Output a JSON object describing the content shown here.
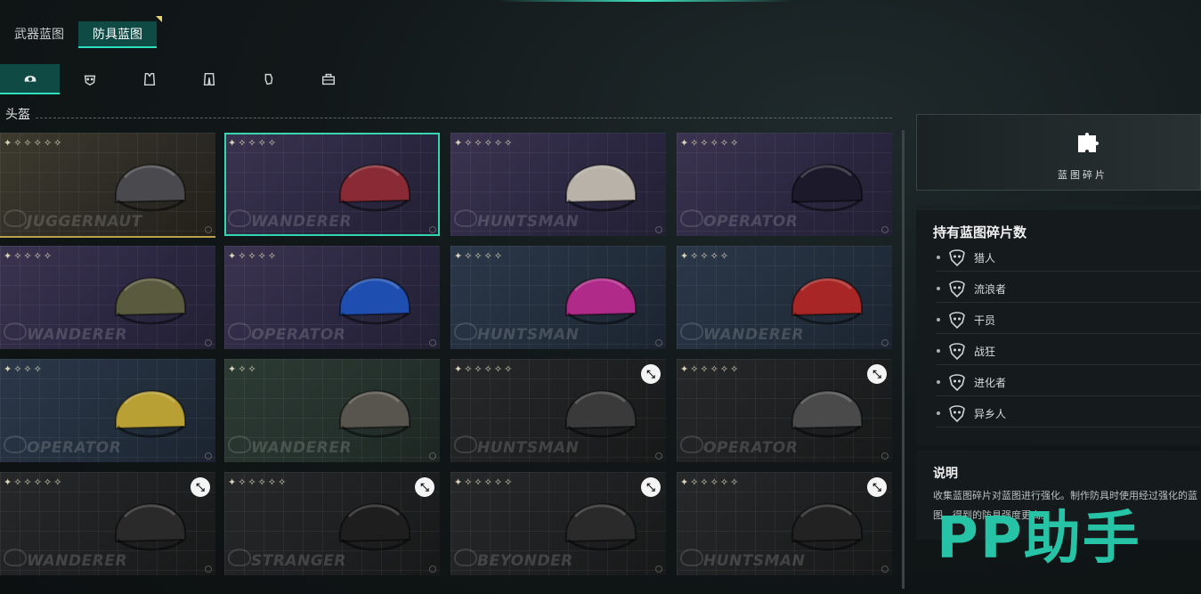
{
  "tabs": [
    {
      "label": "武器蓝图",
      "active": false
    },
    {
      "label": "防具蓝图",
      "active": true
    }
  ],
  "categories": [
    {
      "icon": "helmet-icon",
      "active": true
    },
    {
      "icon": "mask-icon",
      "active": false
    },
    {
      "icon": "armor-vest-icon",
      "active": false
    },
    {
      "icon": "pants-icon",
      "active": false
    },
    {
      "icon": "gloves-icon",
      "active": false
    },
    {
      "icon": "backpack-icon",
      "active": false
    }
  ],
  "section": {
    "title": "头盔"
  },
  "cards": [
    {
      "name": "JUGGERNAUT",
      "stars": "✦✧✧✧✧✧",
      "theme": "gold",
      "locked": false,
      "selected": false,
      "item_color": "#4a4a4e"
    },
    {
      "name": "WANDERER",
      "stars": "✦✧✧✧✧",
      "theme": "purple",
      "locked": false,
      "selected": true,
      "item_color": "#8a2a34"
    },
    {
      "name": "HUNTSMAN",
      "stars": "✦✧✧✧✧✧",
      "theme": "purple",
      "locked": false,
      "selected": false,
      "item_color": "#b8b2a8"
    },
    {
      "name": "OPERATOR",
      "stars": "✦✧✧✧✧✧",
      "theme": "purple",
      "locked": false,
      "selected": false,
      "item_color": "#1c1a2a"
    },
    {
      "name": "WANDERER",
      "stars": "✦✧✧✧✧",
      "theme": "purple",
      "locked": false,
      "selected": false,
      "item_color": "#5a5a3e"
    },
    {
      "name": "OPERATOR",
      "stars": "✦✧✧✧✧",
      "theme": "purple",
      "locked": false,
      "selected": false,
      "item_color": "#1e4fb0"
    },
    {
      "name": "HUNTSMAN",
      "stars": "✦✧✧✧✧",
      "theme": "blue",
      "locked": false,
      "selected": false,
      "item_color": "#b02a8a"
    },
    {
      "name": "WANDERER",
      "stars": "✦✧✧✧✧",
      "theme": "blue",
      "locked": false,
      "selected": false,
      "item_color": "#a82626"
    },
    {
      "name": "OPERATOR",
      "stars": "✦✧✧✧",
      "theme": "blue",
      "locked": false,
      "selected": false,
      "item_color": "#b8a034"
    },
    {
      "name": "WANDERER",
      "stars": "✦✧✧",
      "theme": "green",
      "locked": false,
      "selected": false,
      "item_color": "#58554e"
    },
    {
      "name": "HUNTSMAN",
      "stars": "✦✧✧✧✧✧",
      "theme": "dark",
      "locked": true,
      "selected": false,
      "item_color": "#3a3a3a"
    },
    {
      "name": "OPERATOR",
      "stars": "✦✧✧✧✧✧",
      "theme": "dark",
      "locked": true,
      "selected": false,
      "item_color": "#4a4a4a"
    },
    {
      "name": "WANDERER",
      "stars": "✦✧✧✧✧✧",
      "theme": "dark",
      "locked": true,
      "selected": false,
      "item_color": "#2a2a2a"
    },
    {
      "name": "STRANGER",
      "stars": "✦✧✧✧✧✧",
      "theme": "dark",
      "locked": true,
      "selected": false,
      "item_color": "#1e1e1e"
    },
    {
      "name": "BEYONDER",
      "stars": "✦✧✧✧✧✧",
      "theme": "dark",
      "locked": true,
      "selected": false,
      "item_color": "#2a2a2a"
    },
    {
      "name": "HUNTSMAN",
      "stars": "✦✧✧✧✧✧",
      "theme": "dark",
      "locked": true,
      "selected": false,
      "item_color": "#222222"
    }
  ],
  "fragments": {
    "label": "蓝图碎片"
  },
  "counts": {
    "title": "持有蓝图碎片数",
    "factions": [
      {
        "name": "猎人",
        "icon": "huntsman-faction-icon"
      },
      {
        "name": "流浪者",
        "icon": "wanderer-faction-icon"
      },
      {
        "name": "干员",
        "icon": "operator-faction-icon"
      },
      {
        "name": "战狂",
        "icon": "juggernaut-faction-icon"
      },
      {
        "name": "进化者",
        "icon": "beyonder-faction-icon"
      },
      {
        "name": "异乡人",
        "icon": "stranger-faction-icon"
      }
    ]
  },
  "description": {
    "title": "说明",
    "text": "收集蓝图碎片对蓝图进行强化。制作防具时使用经过强化的蓝图，得到的防具强度更高。"
  },
  "watermark": {
    "text": "PP助手"
  },
  "colors": {
    "accent": "#2ee0bf",
    "selected_border": "#31d6b0",
    "tab_active_bg": "#0f4a44"
  }
}
